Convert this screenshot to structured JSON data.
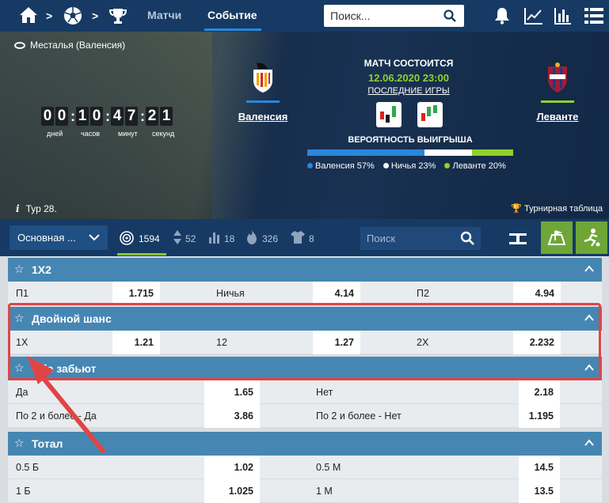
{
  "nav": {
    "tabs": [
      {
        "label": "Матчи"
      },
      {
        "label": "Событие"
      }
    ],
    "search_placeholder": "Поиск..."
  },
  "hero": {
    "stadium": "Месталья (Валенсия)",
    "timer": {
      "digits": [
        "0",
        "0",
        "1",
        "0",
        "4",
        "7",
        "2",
        "1"
      ],
      "labels": [
        "дней",
        "часов",
        "минут",
        "секунд"
      ]
    },
    "round": "Тур 28.",
    "standings_link": "Турнирная таблица",
    "home_team": {
      "name": "Валенсия",
      "color": "#2b87d9"
    },
    "away_team": {
      "name": "Леванте",
      "color": "#8ed22a"
    },
    "match_status": "МАТЧ СОСТОИТСЯ",
    "match_date": "12.06.2020 23:00",
    "last_games": "ПОСЛЕДНИЕ ИГРЫ",
    "win_probability": {
      "title": "ВЕРОЯТНОСТЬ ВЫИГРЫША",
      "home": {
        "label": "Валенсия 57%",
        "value": 57,
        "color": "#2b87d9"
      },
      "draw": {
        "label": "Ничья 23%",
        "value": 23,
        "color": "#ffffff"
      },
      "away": {
        "label": "Леванте 20%",
        "value": 20,
        "color": "#8ed22a"
      }
    }
  },
  "toolbar": {
    "market_select": "Основная ...",
    "stats": [
      {
        "icon": "target-icon",
        "value": "1594"
      },
      {
        "icon": "updown-icon",
        "value": "52"
      },
      {
        "icon": "bars-icon",
        "value": "18"
      },
      {
        "icon": "fire-icon",
        "value": "326"
      },
      {
        "icon": "shirt-icon",
        "value": "8"
      }
    ],
    "search_placeholder": "Поиск"
  },
  "markets": [
    {
      "title": "1X2",
      "rows": [
        [
          {
            "name": "П1",
            "odd": "1.715"
          },
          {
            "name": "Ничья",
            "odd": "4.14"
          },
          {
            "name": "П2",
            "odd": "4.94"
          }
        ]
      ]
    },
    {
      "title": "Двойной шанс",
      "rows": [
        [
          {
            "name": "1X",
            "odd": "1.21"
          },
          {
            "name": "12",
            "odd": "1.27"
          },
          {
            "name": "2X",
            "odd": "2.232"
          }
        ]
      ]
    },
    {
      "title": "Обе забьют",
      "rows": [
        [
          {
            "name": "Да",
            "odd": "1.65"
          },
          {
            "name": "Нет",
            "odd": "2.18"
          }
        ],
        [
          {
            "name": "По 2 и более - Да",
            "odd": "3.86"
          },
          {
            "name": "По 2 и более - Нет",
            "odd": "1.195"
          }
        ]
      ]
    },
    {
      "title": "Тотал",
      "rows": [
        [
          {
            "name": "0.5 Б",
            "odd": "1.02"
          },
          {
            "name": "0.5 М",
            "odd": "14.5"
          }
        ],
        [
          {
            "name": "1 Б",
            "odd": "1.025"
          },
          {
            "name": "1 М",
            "odd": "13.5"
          }
        ]
      ]
    }
  ],
  "annotation_color": "#e04545"
}
